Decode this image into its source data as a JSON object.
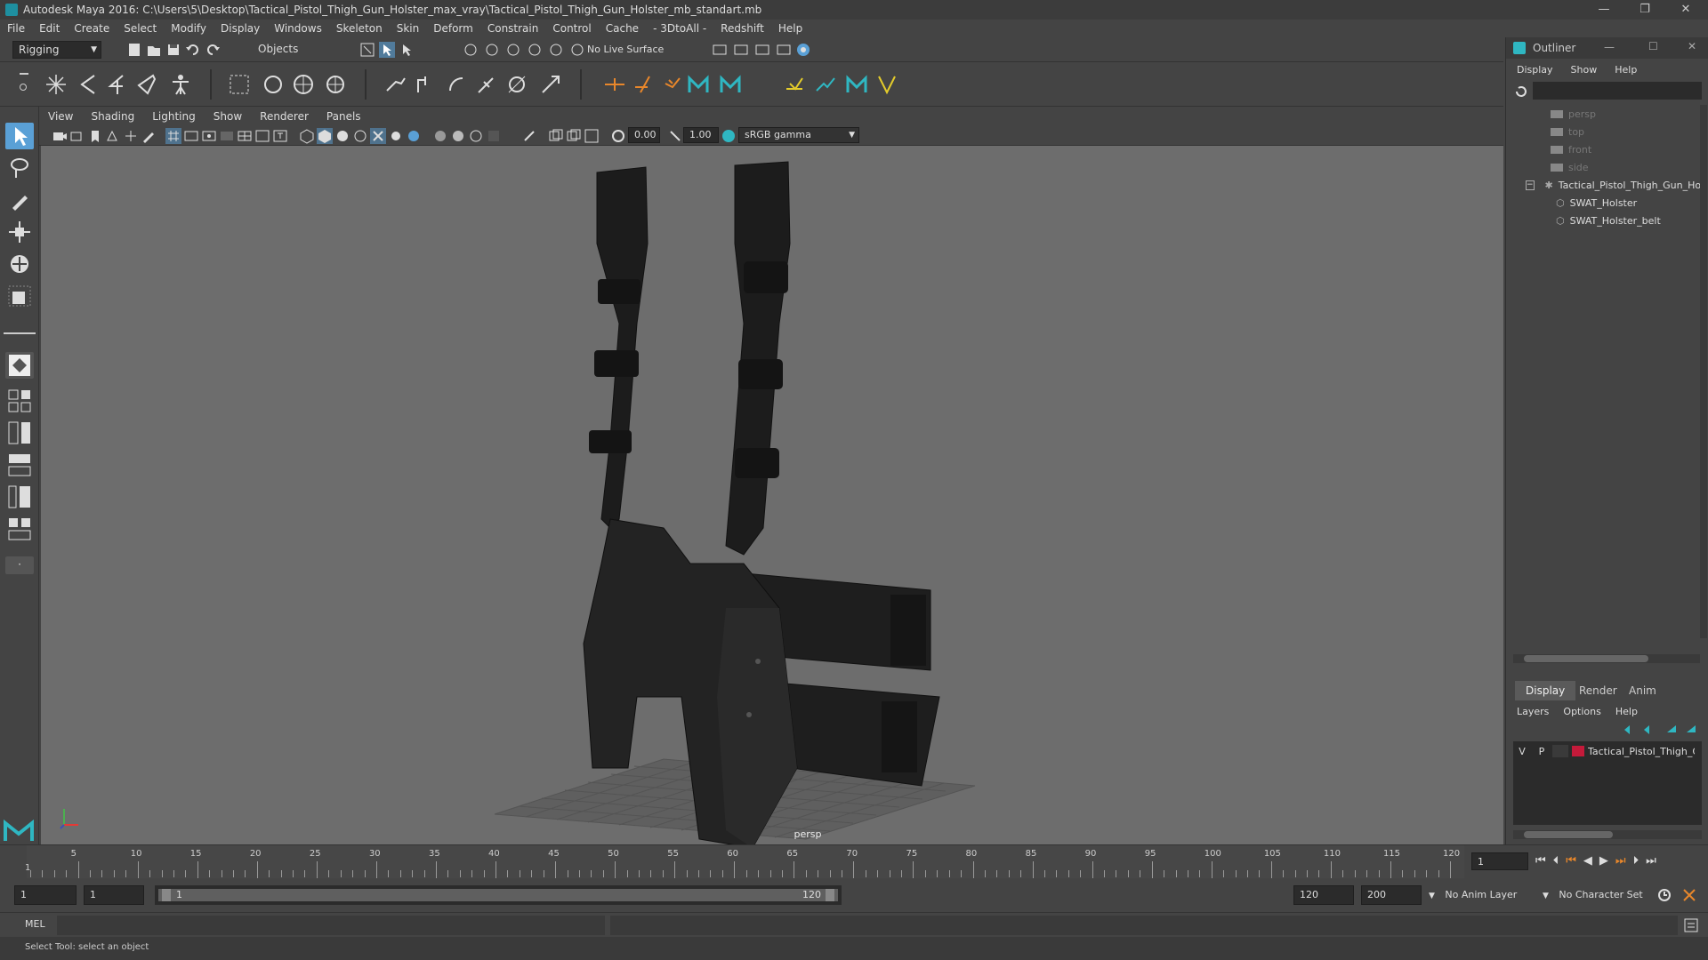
{
  "window": {
    "title": "Autodesk Maya 2016: C:\\Users\\5\\Desktop\\Tactical_Pistol_Thigh_Gun_Holster_max_vray\\Tactical_Pistol_Thigh_Gun_Holster_mb_standart.mb",
    "minimize": "—",
    "restore": "❐",
    "close": "✕"
  },
  "menu": [
    "File",
    "Edit",
    "Create",
    "Select",
    "Modify",
    "Display",
    "Windows",
    "Skeleton",
    "Skin",
    "Deform",
    "Constrain",
    "Control",
    "Cache",
    "- 3DtoAll -",
    "Redshift",
    "Help"
  ],
  "shelf": {
    "menuset": "Rigging",
    "selection_mode": "Objects",
    "live_surface": "No Live Surface"
  },
  "viewport": {
    "menu": [
      "View",
      "Shading",
      "Lighting",
      "Show",
      "Renderer",
      "Panels"
    ],
    "exposure": "0.00",
    "gamma": "1.00",
    "colorspace": "sRGB gamma",
    "camera_label": "persp"
  },
  "outliner": {
    "title": "Outliner",
    "menu": [
      "Display",
      "Show",
      "Help"
    ],
    "items": [
      {
        "label": "persp",
        "dim": true
      },
      {
        "label": "top",
        "dim": true
      },
      {
        "label": "front",
        "dim": true
      },
      {
        "label": "side",
        "dim": true
      },
      {
        "label": "Tactical_Pistol_Thigh_Gun_Holster",
        "dim": false
      },
      {
        "label": "SWAT_Holster",
        "dim": false
      },
      {
        "label": "SWAT_Holster_belt",
        "dim": false
      }
    ]
  },
  "layers": {
    "tabs": [
      "Display",
      "Render",
      "Anim"
    ],
    "menu": [
      "Layers",
      "Options",
      "Help"
    ],
    "row": {
      "v": "V",
      "p": "P",
      "name": "Tactical_Pistol_Thigh_Gun_Holster",
      "color": "#c41a3a"
    }
  },
  "timeline": {
    "ticks": [
      "5",
      "10",
      "15",
      "20",
      "25",
      "30",
      "35",
      "40",
      "45",
      "50",
      "55",
      "60",
      "65",
      "70",
      "75",
      "80",
      "85",
      "90",
      "95",
      "100",
      "105",
      "110",
      "115",
      "120"
    ],
    "first_tick": "1",
    "current_frame": "1"
  },
  "range": {
    "start": "1",
    "playback_start": "1",
    "slider_start": "1",
    "slider_end": "120",
    "playback_end": "120",
    "end": "200",
    "anim_layer": "No Anim Layer",
    "character_set": "No Character Set"
  },
  "mel": {
    "label": "MEL"
  },
  "status": {
    "text": "Select Tool: select an object"
  },
  "colors": {
    "accent": "#5aa0d6",
    "maya_teal": "#2fb7c2",
    "layer_red": "#c41a3a"
  }
}
